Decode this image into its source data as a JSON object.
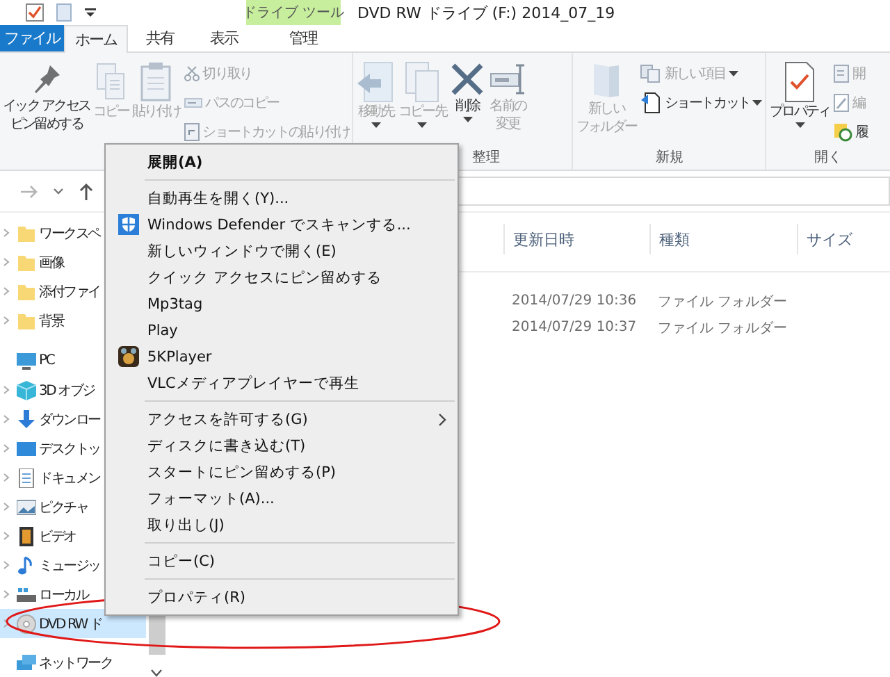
{
  "title_bar": {
    "context_tab": "ドライブ ツール",
    "title": "DVD RW ドライブ (F:) 2014_07_19"
  },
  "tabs": [
    {
      "label": "ファイル",
      "kind": "file",
      "selected": false
    },
    {
      "label": "ホーム",
      "kind": "normal",
      "selected": true
    },
    {
      "label": "共有",
      "kind": "normal",
      "selected": false
    },
    {
      "label": "表示",
      "kind": "normal",
      "selected": false
    },
    {
      "label": "管理",
      "kind": "context",
      "selected": false
    }
  ],
  "ribbon": {
    "groups": [
      {
        "items": [
          {
            "kind": "large",
            "lines": [
              "イック アクセス",
              "ピン留めする"
            ],
            "disabled": false,
            "dropdown": false
          },
          {
            "kind": "large",
            "lines": [
              "コピー"
            ],
            "disabled": true,
            "dropdown": false
          },
          {
            "kind": "large",
            "lines": [
              "貼り付け"
            ],
            "disabled": true,
            "dropdown": false
          },
          {
            "kind": "small",
            "lines": [
              "切り取り"
            ],
            "disabled": true,
            "dropdown": false
          },
          {
            "kind": "small",
            "lines": [
              "パスのコピー"
            ],
            "disabled": true,
            "dropdown": false
          },
          {
            "kind": "small",
            "lines": [
              "ショートカットの貼り付け"
            ],
            "disabled": true,
            "dropdown": false
          }
        ]
      },
      {
        "label": "整理",
        "items": [
          {
            "kind": "large",
            "lines": [
              "移動先"
            ],
            "disabled": true,
            "dropdown": true
          },
          {
            "kind": "large",
            "lines": [
              "コピー先"
            ],
            "disabled": true,
            "dropdown": true
          },
          {
            "kind": "large",
            "lines": [
              "削除"
            ],
            "disabled": false,
            "dropdown": true
          },
          {
            "kind": "large",
            "lines": [
              "名前の",
              "変更"
            ],
            "disabled": true,
            "dropdown": false
          }
        ]
      },
      {
        "label": "新規",
        "items": [
          {
            "kind": "large",
            "lines": [
              "新しい",
              "フォルダー"
            ],
            "disabled": true,
            "dropdown": false
          },
          {
            "kind": "small",
            "lines": [
              "新しい項目"
            ],
            "disabled": true,
            "dropdown": true
          },
          {
            "kind": "small",
            "lines": [
              "ショートカット"
            ],
            "disabled": false,
            "dropdown": true
          }
        ]
      },
      {
        "label": "開く",
        "items": [
          {
            "kind": "large",
            "lines": [
              "プロパティ"
            ],
            "disabled": false,
            "dropdown": true
          },
          {
            "kind": "small",
            "lines": [
              "開"
            ],
            "disabled": true,
            "dropdown": false
          },
          {
            "kind": "small",
            "lines": [
              "編"
            ],
            "disabled": true,
            "dropdown": false
          },
          {
            "kind": "small",
            "lines": [
              "履"
            ],
            "disabled": false,
            "dropdown": false
          }
        ]
      }
    ]
  },
  "navigation": {
    "items": [
      {
        "label": "ワークスペ",
        "kind": "folder",
        "selected": false,
        "expanded": false
      },
      {
        "label": "画像",
        "kind": "folder",
        "selected": false,
        "expanded": false
      },
      {
        "label": "添付ファイ",
        "kind": "folder",
        "selected": false,
        "expanded": false
      },
      {
        "label": "背景",
        "kind": "folder",
        "selected": false,
        "expanded": false
      },
      {
        "label": "PC",
        "kind": "pc",
        "selected": false,
        "children": [
          {
            "label": "3D オブジ",
            "kind": "cube",
            "selected": false,
            "expanded": false
          },
          {
            "label": "ダウンロー",
            "kind": "download",
            "selected": false,
            "expanded": false
          },
          {
            "label": "デスクトッ",
            "kind": "desktop",
            "selected": false,
            "expanded": false
          },
          {
            "label": "ドキュメン",
            "kind": "document",
            "selected": false,
            "expanded": false
          },
          {
            "label": "ピクチャ",
            "kind": "pictures",
            "selected": false,
            "expanded": false
          },
          {
            "label": "ビデオ",
            "kind": "video",
            "selected": false,
            "expanded": false
          },
          {
            "label": "ミュージッ",
            "kind": "music",
            "selected": false,
            "expanded": false
          },
          {
            "label": "ローカル",
            "kind": "disk",
            "selected": false,
            "expanded": false
          },
          {
            "label": "DVD RW ド",
            "kind": "dvd",
            "selected": true,
            "expanded": false
          }
        ]
      },
      {
        "label": "ネットワーク",
        "kind": "network",
        "selected": false
      }
    ]
  },
  "file_list": {
    "columns": [
      "更新日時",
      "種類",
      "サイズ"
    ],
    "rows": [
      {
        "cells": [
          "2014/07/29 10:36",
          "ファイル フォルダー"
        ]
      },
      {
        "cells": [
          "2014/07/29 10:37",
          "ファイル フォルダー"
        ]
      }
    ]
  },
  "context_menu": {
    "items": [
      {
        "kind": "default",
        "label": "展開(A)"
      },
      {
        "kind": "separator"
      },
      {
        "kind": "plain",
        "label": "自動再生を開く(Y)..."
      },
      {
        "kind": "shield",
        "label": "Windows Defender でスキャンする..."
      },
      {
        "kind": "plain",
        "label": "新しいウィンドウで開く(E)"
      },
      {
        "kind": "plain",
        "label": "クイック アクセスにピン留めする"
      },
      {
        "kind": "plain",
        "label": "Mp3tag"
      },
      {
        "kind": "plain",
        "label": "Play"
      },
      {
        "kind": "player",
        "label": "5KPlayer"
      },
      {
        "kind": "plain",
        "label": "VLCメディアプレイヤーで再生"
      },
      {
        "kind": "separator"
      },
      {
        "kind": "submenu",
        "label": "アクセスを許可する(G)"
      },
      {
        "kind": "plain",
        "label": "ディスクに書き込む(T)"
      },
      {
        "kind": "plain",
        "label": "スタートにピン留めする(P)"
      },
      {
        "kind": "plain",
        "label": "フォーマット(A)..."
      },
      {
        "kind": "plain",
        "label": "取り出し(J)"
      },
      {
        "kind": "separator"
      },
      {
        "kind": "plain",
        "label": "コピー(C)"
      },
      {
        "kind": "separator"
      },
      {
        "kind": "plain",
        "label": "プロパティ(R)"
      }
    ]
  }
}
